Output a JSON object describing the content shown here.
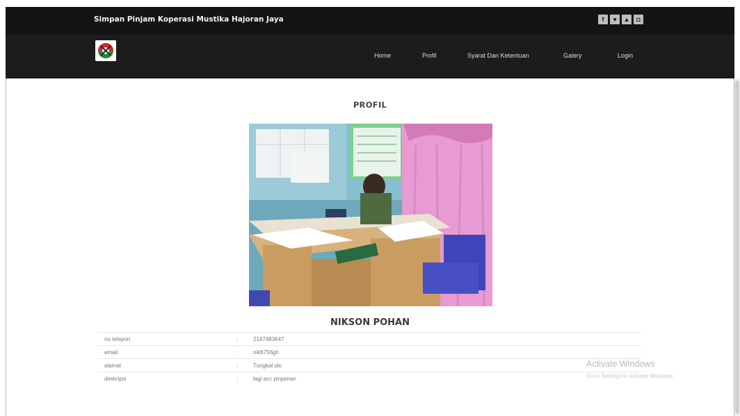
{
  "header": {
    "site_title": "Simpan Pinjam Koperasi Mustika Hajoran Jaya",
    "social_icons": [
      "facebook-icon",
      "twitter-icon",
      "youtube-icon",
      "instagram-icon"
    ]
  },
  "nav": {
    "items": [
      {
        "label": "Home"
      },
      {
        "label": "Profil"
      },
      {
        "label": "Syarat Dan Ketentuan"
      },
      {
        "label": "Galery"
      },
      {
        "label": "Login"
      }
    ]
  },
  "main": {
    "heading": "PROFIL",
    "name": "NIKSON POHAN",
    "rows": [
      {
        "label": "no telepon",
        "value": "2147483647"
      },
      {
        "label": "email",
        "value": "nik6756gh"
      },
      {
        "label": "alamat",
        "value": "Tungkal ulu"
      },
      {
        "label": "deskripsi",
        "value": "lagi acc pinjaman"
      }
    ],
    "separator": ":"
  },
  "watermark": {
    "line1": "Activate Windows",
    "line2": "Go to Settings to activate Windows."
  },
  "colors": {
    "topbar": "#141414",
    "navbar": "#1c1c1c",
    "text": "#444444"
  }
}
